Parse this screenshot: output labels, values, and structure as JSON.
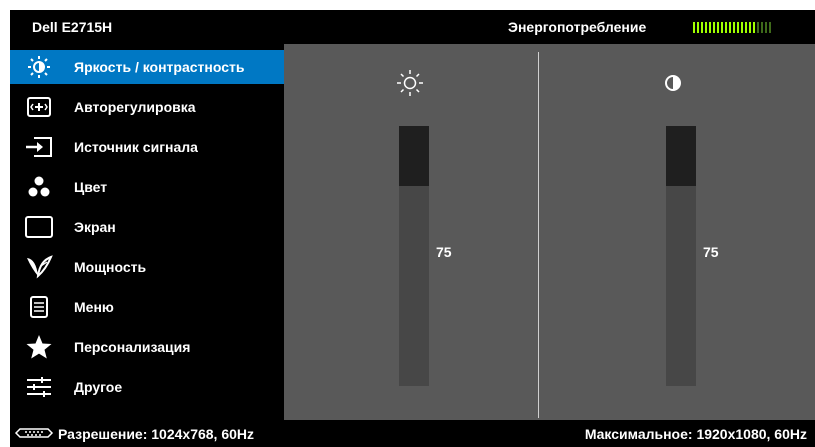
{
  "header": {
    "model": "Dell E2715H",
    "energy_label": "Энергопотребление",
    "energy_level_fraction": 0.8
  },
  "menu": {
    "items": [
      {
        "label": "Яркость / контрастность",
        "icon": "brightness-contrast-icon",
        "active": true
      },
      {
        "label": "Авторегулировка",
        "icon": "auto-adjust-icon",
        "active": false
      },
      {
        "label": "Источник сигнала",
        "icon": "input-source-icon",
        "active": false
      },
      {
        "label": "Цвет",
        "icon": "color-icon",
        "active": false
      },
      {
        "label": "Экран",
        "icon": "display-icon",
        "active": false
      },
      {
        "label": "Мощность",
        "icon": "power-leaf-icon",
        "active": false
      },
      {
        "label": "Меню",
        "icon": "menu-icon",
        "active": false
      },
      {
        "label": "Персонализация",
        "icon": "star-icon",
        "active": false
      },
      {
        "label": "Другое",
        "icon": "sliders-icon",
        "active": false
      }
    ]
  },
  "brightness": {
    "icon": "sun-icon",
    "value": "75",
    "level": 75
  },
  "contrast": {
    "icon": "contrast-circle-icon",
    "value": "75",
    "level": 75
  },
  "footer": {
    "resolution": "Разрешение: 1024x768, 60Hz",
    "max": "Максимальное: 1920x1080, 60Hz"
  },
  "colors": {
    "active_bg": "#0078c4",
    "panel_bg": "#595959",
    "energy_bar": "#a0ff00"
  }
}
